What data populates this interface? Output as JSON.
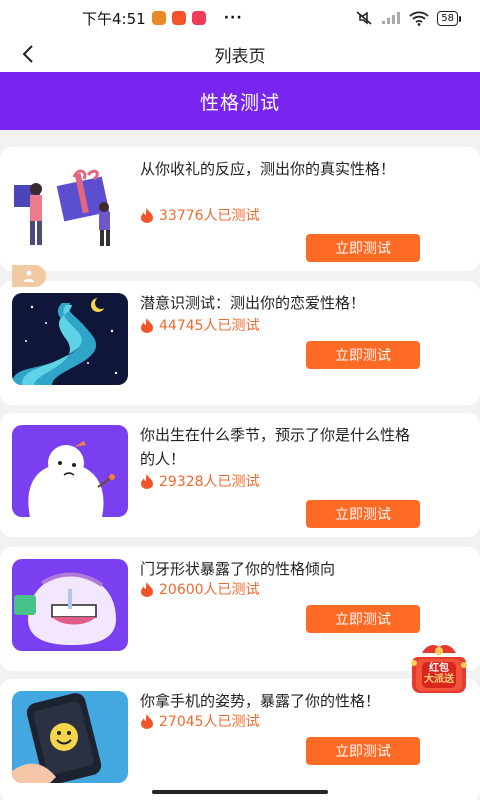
{
  "status_bar": {
    "time": "下午4:51",
    "more": "···",
    "battery": "58"
  },
  "nav": {
    "title": "列表页"
  },
  "banner": {
    "title": "性格测试"
  },
  "tests": [
    {
      "title": "从你收礼的反应，测出你的真实性格！",
      "count": "33776人已测试",
      "button": "立即测试"
    },
    {
      "title": "潜意识测试：测出你的恋爱性格！",
      "count": "44745人已测试",
      "button": "立即测试"
    },
    {
      "title": "你出生在什么季节，预示了你是什么性格的人！",
      "count": "29328人已测试",
      "button": "立即测试"
    },
    {
      "title": "门牙形状暴露了你的性格倾向",
      "count": "20600人已测试",
      "button": "立即测试"
    },
    {
      "title": "你拿手机的姿势，暴露了你的性格！",
      "count": "27045人已测试",
      "button": "立即测试"
    }
  ],
  "red_packet": {
    "line1": "红包",
    "line2": "大派送"
  },
  "colors": {
    "banner": "#7a24ef",
    "button": "#ff6a24",
    "count": "#f06a2e"
  }
}
